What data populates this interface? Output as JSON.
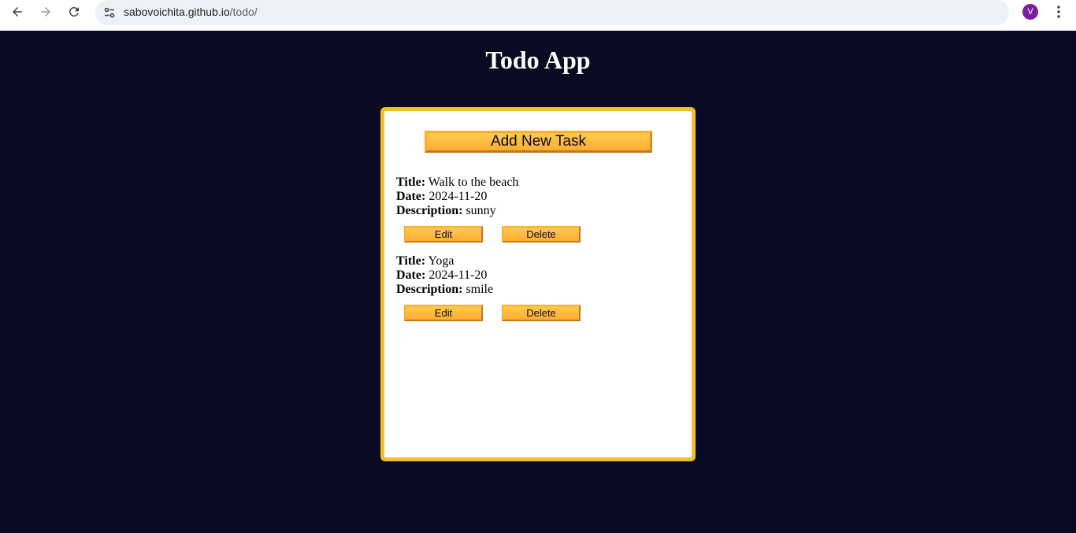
{
  "browser": {
    "url_host": "sabovoichita.github.io",
    "url_path": "/todo/",
    "avatar_initial": "V",
    "icons": {
      "back": "arrow-left-icon",
      "forward": "arrow-right-icon",
      "reload": "reload-icon",
      "site_info": "tune-icon",
      "bookmark": "star-icon",
      "menu": "kebab-menu-icon"
    }
  },
  "app": {
    "title": "Todo App",
    "add_button_label": "Add New Task",
    "labels": {
      "title": "Title:",
      "date": "Date:",
      "description": "Description:"
    },
    "tasks": [
      {
        "title": "Walk to the beach",
        "date": "2024-11-20",
        "description": "sunny",
        "edit_label": "Edit",
        "delete_label": "Delete"
      },
      {
        "title": "Yoga",
        "date": "2024-11-20",
        "description": "smile",
        "edit_label": "Edit",
        "delete_label": "Delete"
      }
    ]
  },
  "colors": {
    "background": "#0a0a23",
    "card_border": "#f1be32",
    "button_fill": "#feac32"
  }
}
